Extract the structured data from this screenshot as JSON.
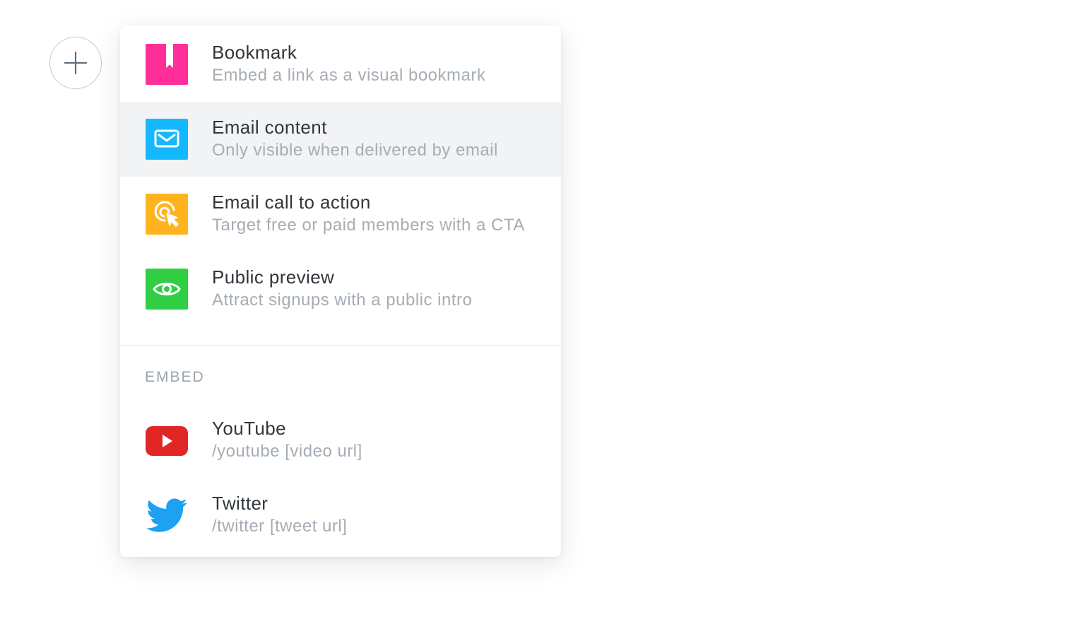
{
  "add_button": {
    "icon": "plus-icon"
  },
  "menu": {
    "items": [
      {
        "title": "Bookmark",
        "description": "Embed a link as a visual bookmark",
        "icon": "bookmark-icon",
        "color": "#ff2e99"
      },
      {
        "title": "Email content",
        "description": "Only visible when delivered by email",
        "icon": "envelope-icon",
        "color": "#14b8ff",
        "highlighted": true
      },
      {
        "title": "Email call to action",
        "description": "Target free or paid members with a CTA",
        "icon": "cursor-click-icon",
        "color": "#ffb41f"
      },
      {
        "title": "Public preview",
        "description": "Attract signups with a public intro",
        "icon": "eye-icon",
        "color": "#30cf43"
      }
    ],
    "embed_section": {
      "header": "EMBED",
      "items": [
        {
          "title": "YouTube",
          "description": "/youtube [video url]",
          "icon": "youtube-icon",
          "color": "#e02627"
        },
        {
          "title": "Twitter",
          "description": "/twitter [tweet url]",
          "icon": "twitter-icon",
          "color": "#1da1f2"
        }
      ]
    }
  }
}
